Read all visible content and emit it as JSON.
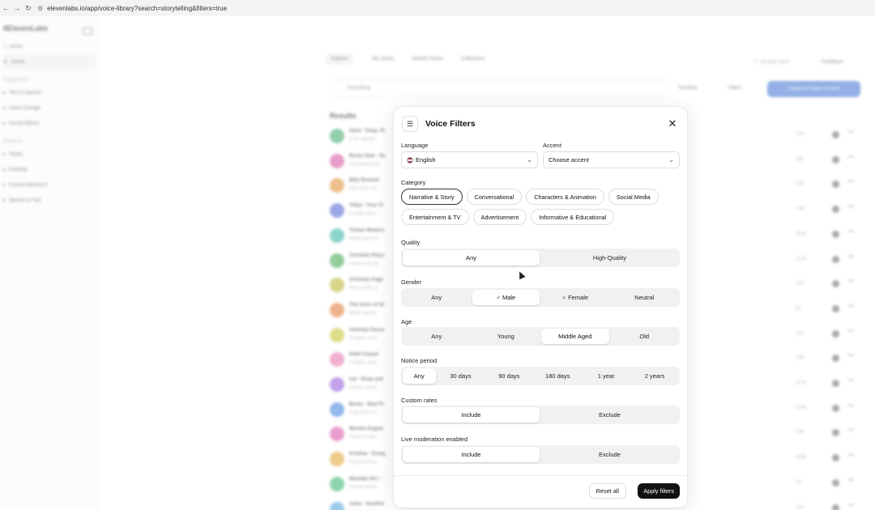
{
  "browser": {
    "url": "elevenlabs.io/app/voice-library?search=storytelling&filters=true"
  },
  "sidebar": {
    "logo": "IIElevenLabs",
    "items": [
      {
        "label": "Home",
        "icon": "home-icon"
      },
      {
        "label": "Voices",
        "icon": "voices-icon"
      }
    ],
    "section_playground": "Playground",
    "playground_items": [
      "Text to Speech",
      "Voice Changer",
      "Sound Effects"
    ],
    "section_products": "Products",
    "product_items": [
      "Studio",
      "Dubbing",
      "Conversational AI",
      "Speech to Text"
    ]
  },
  "main": {
    "tabs": [
      "Explore",
      "My Voices",
      "Default Voices",
      "Collections"
    ],
    "credits": "7 / 10 slots used",
    "feedback": "Feedback",
    "search_value": "storytelling",
    "trending": "Trending",
    "filters": "Filters",
    "create_button": "Create or Clone a Voice",
    "results_title": "Results",
    "voices": [
      {
        "name": "Saint - Deep, St",
        "desc": "A rich, gravelly",
        "meta": "7.5K",
        "color": "#3aa56a"
      },
      {
        "name": "Bruno Siak - Su",
        "desc": "Deep passionate",
        "meta": "10K",
        "color": "#d44fa1"
      },
      {
        "name": "Billy Richard",
        "desc": "Calm male voic",
        "meta": "2.3K",
        "color": "#e08a2d"
      },
      {
        "name": "Vidya - Your Cl",
        "desc": "A vitality, warm",
        "meta": "7.8K",
        "color": "#4b5fcf"
      },
      {
        "name": "Tristan Modera",
        "desc": "Middle aged ma",
        "meta": "18.5K",
        "color": "#2fb3a0"
      },
      {
        "name": "Christian Pless",
        "desc": "A warm and cap",
        "meta": "12.7K",
        "color": "#3aa548"
      },
      {
        "name": "Christian Page",
        "desc": "Deep, steady, a",
        "meta": "3.3K",
        "color": "#b6b42a"
      },
      {
        "name": "The Voice of St",
        "desc": "Middle aged Br",
        "meta": "2K",
        "color": "#e0762d"
      },
      {
        "name": "Svandys Darus",
        "desc": "A mature, resor",
        "meta": "2.1K",
        "color": "#c4c42d"
      },
      {
        "name": "Kadir Kayıpc",
        "desc": "A mature, trans",
        "meta": "2.9K",
        "color": "#e46fa8"
      },
      {
        "name": "Cal - Deep and",
        "desc": "A deep, commi",
        "meta": "12.7K",
        "color": "#8f55d8"
      },
      {
        "name": "Bunty - Reel Pr",
        "desc": "A vibrant AI voi",
        "meta": "21.9K",
        "color": "#3b7fd8"
      },
      {
        "name": "Monika Sogam",
        "desc": "Perfect for Stor",
        "meta": "7.8K",
        "color": "#d94fa9"
      },
      {
        "name": "Krishna - Energ",
        "desc": "Krishna is the p",
        "meta": "33.8K",
        "color": "#e0a02d"
      },
      {
        "name": "Mustafa Glcr -",
        "desc": "Smooth storyte",
        "meta": "167",
        "color": "#2fb36a"
      },
      {
        "name": "Jules - Soothin",
        "desc": "Smooth and cal",
        "meta": "2.3K",
        "color": "#4b9fd8"
      }
    ]
  },
  "modal": {
    "title": "Voice Filters",
    "language_label": "Language",
    "language_value": "English",
    "accent_label": "Accent",
    "accent_value": "Choose accent",
    "category_label": "Category",
    "categories": [
      "Narrative & Story",
      "Conversational",
      "Characters & Animation",
      "Social Media",
      "Entertainment & TV",
      "Advertisement",
      "Informative & Educational"
    ],
    "quality_label": "Quality",
    "quality_options": [
      "Any",
      "High-Quality"
    ],
    "gender_label": "Gender",
    "gender_options": [
      "Any",
      "♂ Male",
      "♀ Female",
      "Neutral"
    ],
    "age_label": "Age",
    "age_options": [
      "Any",
      "Young",
      "Middle Aged",
      "Old"
    ],
    "notice_label": "Notice period",
    "notice_options": [
      "Any",
      "30 days",
      "90 days",
      "180 days",
      "1 year",
      "2 years"
    ],
    "custom_rates_label": "Custom rates",
    "custom_rates_options": [
      "Include",
      "Exclude"
    ],
    "live_mod_label": "Live moderation enabled",
    "live_mod_options": [
      "Include",
      "Exclude"
    ],
    "reset_label": "Reset all",
    "apply_label": "Apply filters"
  }
}
